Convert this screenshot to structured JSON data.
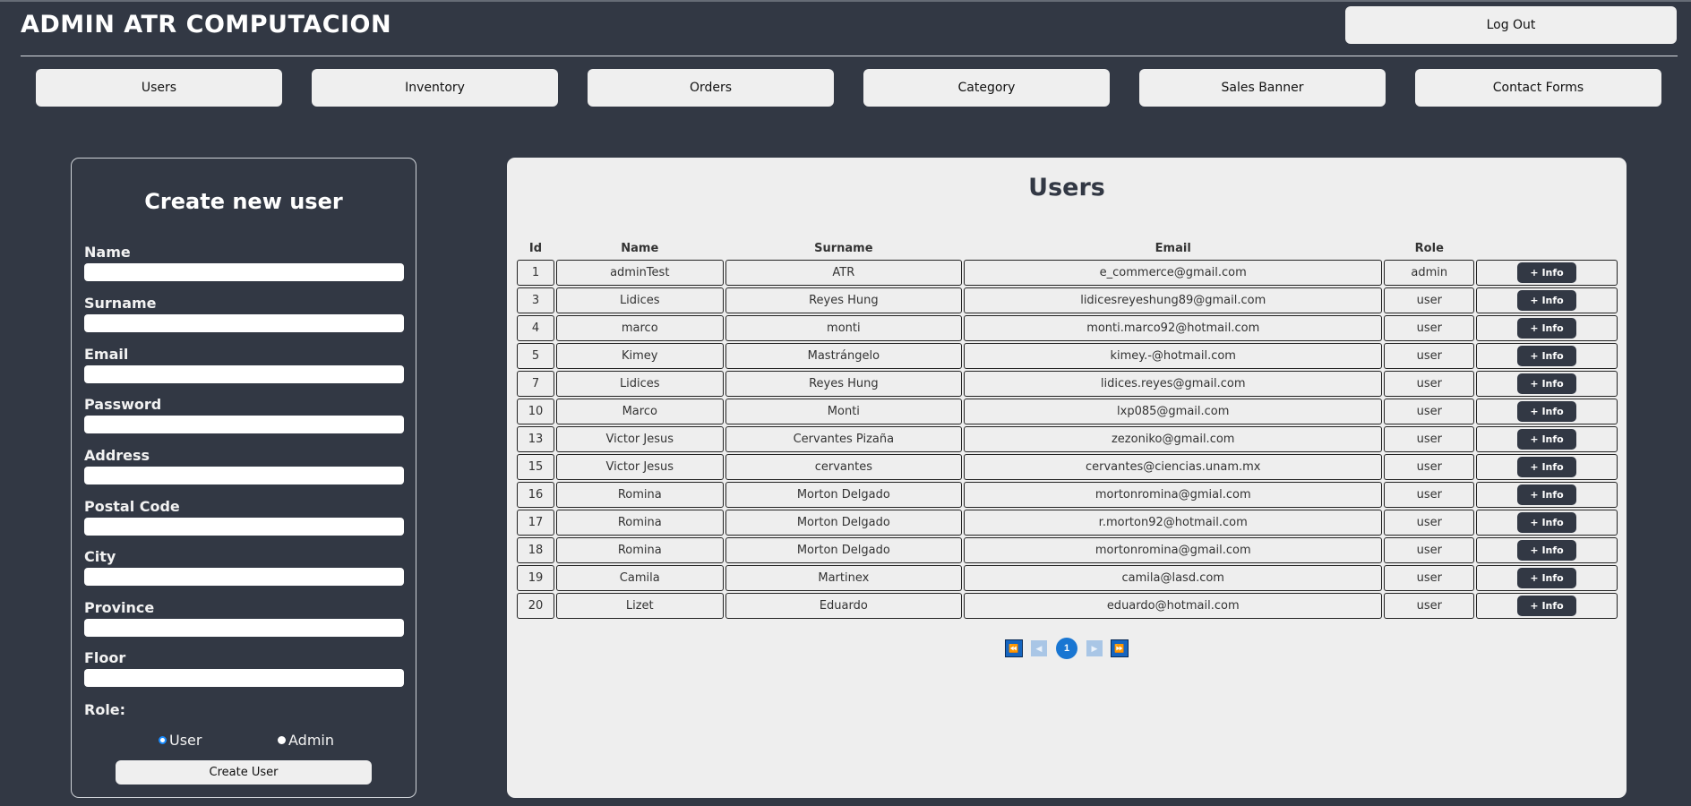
{
  "header": {
    "brand": "ADMIN ATR COMPUTACION",
    "logout_label": "Log Out"
  },
  "nav": {
    "items": [
      {
        "label": "Users"
      },
      {
        "label": "Inventory"
      },
      {
        "label": "Orders"
      },
      {
        "label": "Category"
      },
      {
        "label": "Sales Banner"
      },
      {
        "label": "Contact Forms"
      }
    ]
  },
  "create_form": {
    "title": "Create new user",
    "fields": [
      {
        "label": "Name",
        "value": ""
      },
      {
        "label": "Surname",
        "value": ""
      },
      {
        "label": "Email",
        "value": ""
      },
      {
        "label": "Password",
        "value": ""
      },
      {
        "label": "Address",
        "value": ""
      },
      {
        "label": "Postal Code",
        "value": ""
      },
      {
        "label": "City",
        "value": ""
      },
      {
        "label": "Province",
        "value": ""
      },
      {
        "label": "Floor",
        "value": ""
      }
    ],
    "role_label": "Role:",
    "role_options": [
      {
        "label": "User",
        "checked": true
      },
      {
        "label": "Admin",
        "checked": false
      }
    ],
    "submit_label": "Create User"
  },
  "users_table": {
    "title": "Users",
    "columns": [
      "Id",
      "Name",
      "Surname",
      "Email",
      "Role",
      ""
    ],
    "info_label": "+ Info",
    "rows": [
      {
        "id": "1",
        "name": "adminTest",
        "surname": "ATR",
        "email": "e_commerce@gmail.com",
        "role": "admin"
      },
      {
        "id": "3",
        "name": "Lidices",
        "surname": "Reyes Hung",
        "email": "lidicesreyeshung89@gmail.com",
        "role": "user"
      },
      {
        "id": "4",
        "name": "marco",
        "surname": "monti",
        "email": "monti.marco92@hotmail.com",
        "role": "user"
      },
      {
        "id": "5",
        "name": "Kimey",
        "surname": "Mastrángelo",
        "email": "kimey.-@hotmail.com",
        "role": "user"
      },
      {
        "id": "7",
        "name": "Lidices",
        "surname": "Reyes Hung",
        "email": "lidices.reyes@gmail.com",
        "role": "user"
      },
      {
        "id": "10",
        "name": "Marco",
        "surname": "Monti",
        "email": "lxp085@gmail.com",
        "role": "user"
      },
      {
        "id": "13",
        "name": "Victor Jesus",
        "surname": "Cervantes Pizaña",
        "email": "zezoniko@gmail.com",
        "role": "user"
      },
      {
        "id": "15",
        "name": "Victor Jesus",
        "surname": "cervantes",
        "email": "cervantes@ciencias.unam.mx",
        "role": "user"
      },
      {
        "id": "16",
        "name": "Romina",
        "surname": "Morton Delgado",
        "email": "mortonromina@gmial.com",
        "role": "user"
      },
      {
        "id": "17",
        "name": "Romina",
        "surname": "Morton Delgado",
        "email": "r.morton92@hotmail.com",
        "role": "user"
      },
      {
        "id": "18",
        "name": "Romina",
        "surname": "Morton Delgado",
        "email": "mortonromina@gmail.com",
        "role": "user"
      },
      {
        "id": "19",
        "name": "Camila",
        "surname": "Martinex",
        "email": "camila@lasd.com",
        "role": "user"
      },
      {
        "id": "20",
        "name": "Lizet",
        "surname": "Eduardo",
        "email": "eduardo@hotmail.com",
        "role": "user"
      }
    ],
    "pagination": {
      "first_icon": "⏪",
      "prev_icon": "◀",
      "current_page": "1",
      "next_icon": "▶",
      "last_icon": "⏩"
    }
  }
}
